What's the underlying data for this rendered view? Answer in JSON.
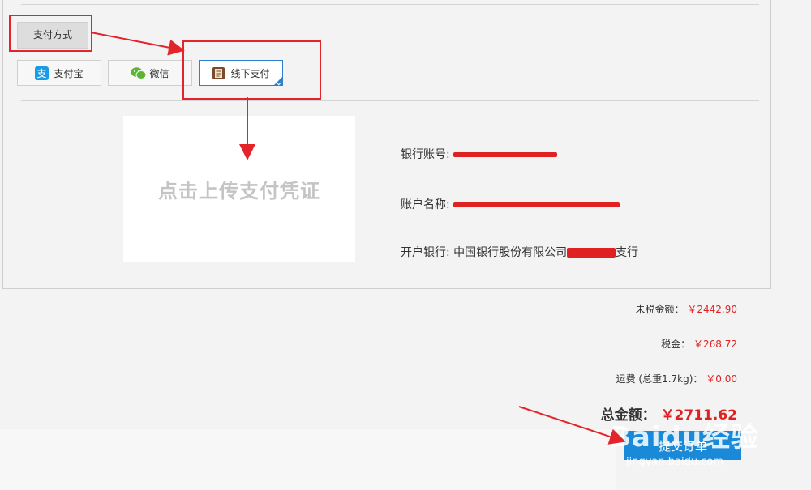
{
  "payment": {
    "section_label": "支付方式",
    "methods": [
      {
        "label": "支付宝",
        "icon": "alipay-icon"
      },
      {
        "label": "微信",
        "icon": "wechat-icon"
      },
      {
        "label": "线下支付",
        "icon": "offline-pay-icon"
      }
    ],
    "selected": "线下支付"
  },
  "upload": {
    "label": "点击上传支付凭证"
  },
  "bank": {
    "account_no_label": "银行账号:",
    "account_name_label": "账户名称:",
    "bank_label": "开户银行:",
    "bank_prefix": "中国银行股份有限公司",
    "bank_suffix": "支行"
  },
  "summary": {
    "pretax_label": "未税金额：",
    "pretax_value": "￥2442.90",
    "tax_label": "税金：",
    "tax_value": "￥268.72",
    "shipping_label": "运费 (总重1.7kg)：",
    "shipping_value": "￥0.00",
    "total_label": "总金额：",
    "total_value": "￥2711.62"
  },
  "submit": {
    "label": "提交订单"
  },
  "watermark": {
    "text": "Baidu经验",
    "sub": "jingyan.baidu.com"
  },
  "colors": {
    "accent": "#1a8ad8",
    "price": "#e02121",
    "annotation": "#e3242b"
  }
}
